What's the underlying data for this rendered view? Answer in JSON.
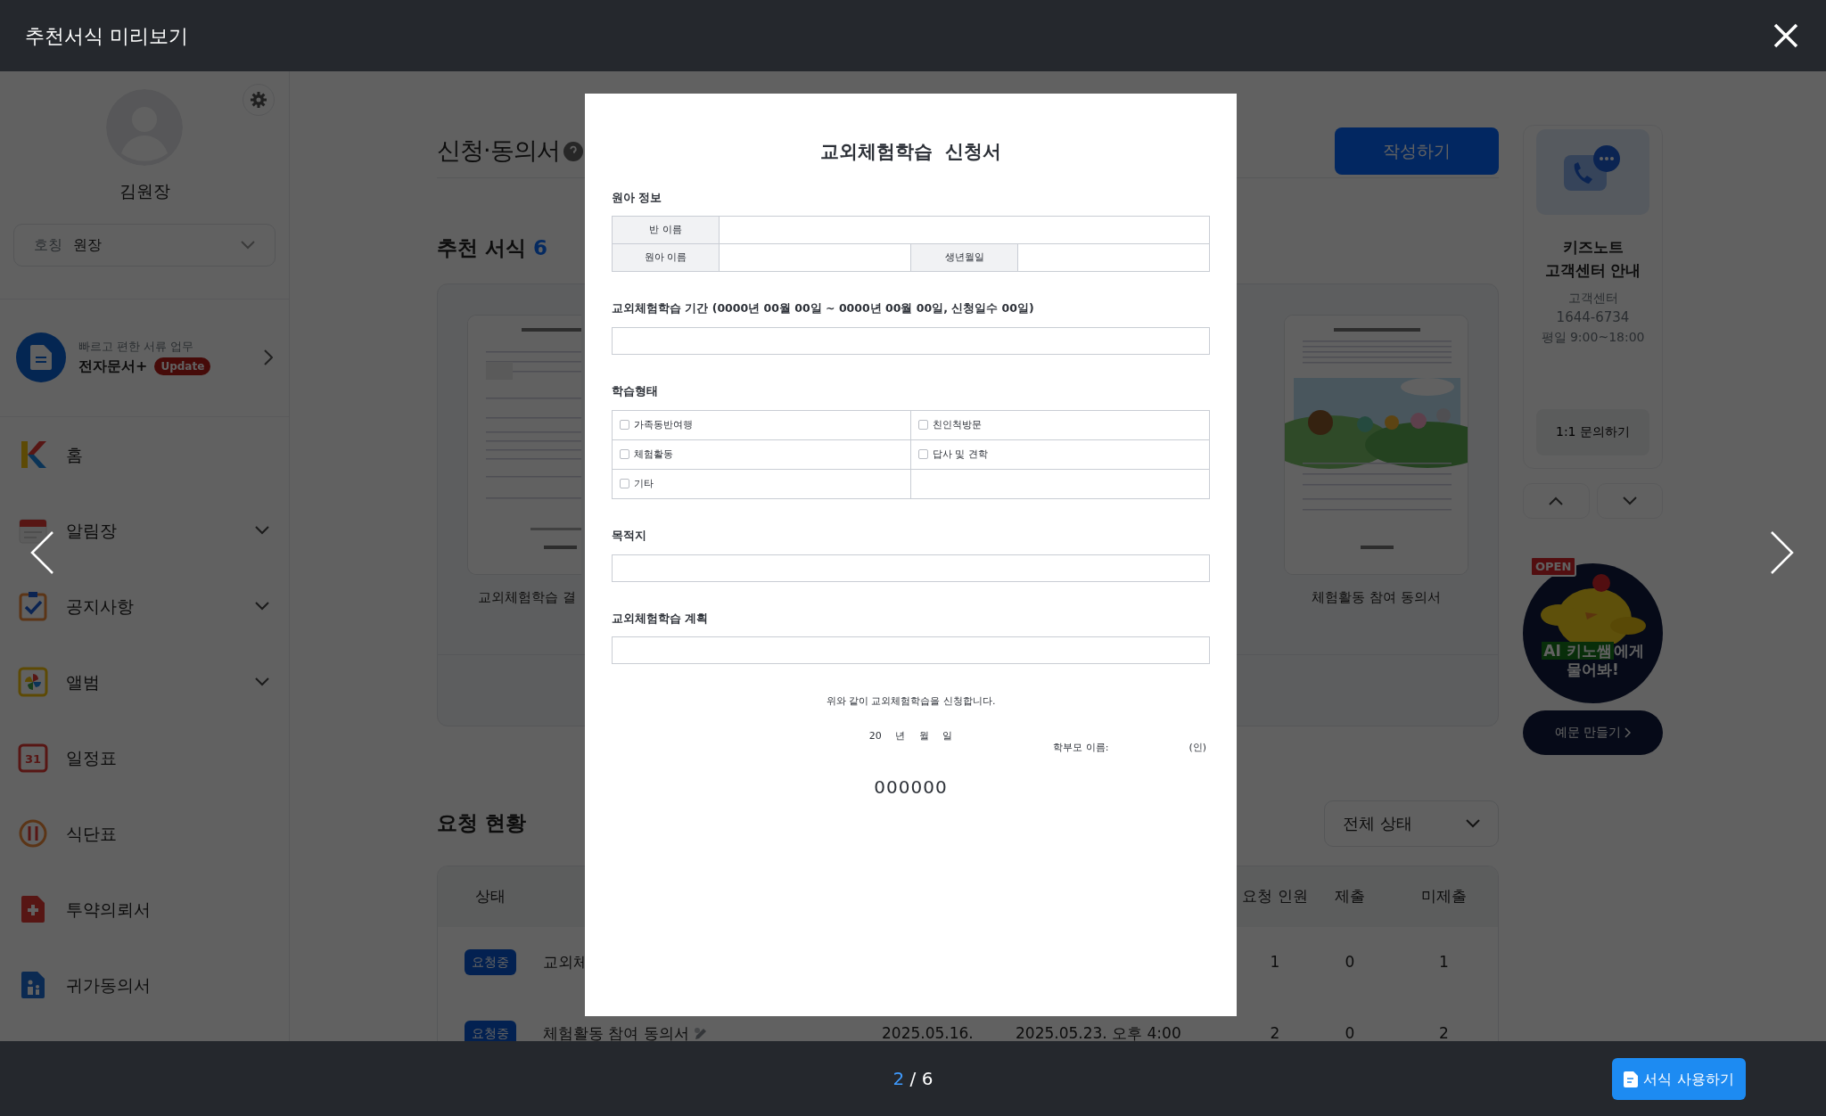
{
  "modal": {
    "title": "추천서식 미리보기",
    "page_current": "2",
    "page_separator": "/",
    "page_total": "6",
    "use_button": "서식 사용하기"
  },
  "document": {
    "title": "교외체험학습 신청서",
    "sections": [
      {
        "kind": "info_table",
        "heading": "원아 정보",
        "rows": [
          [
            "반 이름"
          ],
          [
            "원아 이름",
            "생년월일"
          ]
        ]
      },
      {
        "kind": "field",
        "heading": "교외체험학습 기간 (0000년 00월 00일 ~ 0000년 00월 00일, 신청일수 00일)"
      },
      {
        "kind": "checkbox_grid",
        "heading": "학습형태",
        "options": [
          {
            "label": "가족동반여행",
            "checked": false
          },
          {
            "label": "친인척방문",
            "checked": false
          },
          {
            "label": "체험활동",
            "checked": false
          },
          {
            "label": "답사 및 견학",
            "checked": false
          },
          {
            "label": "기타",
            "checked": false
          }
        ]
      },
      {
        "kind": "field",
        "heading": "목적지"
      },
      {
        "kind": "field",
        "heading": "교외체험학습 계획"
      }
    ],
    "statement": "위와 같이 교외체험학습을 신청합니다.",
    "date_line": "20 년 월 일",
    "signature_label": "학부모 이름:",
    "seal": "(인)",
    "organization": "000000"
  },
  "sidebar": {
    "user_name": "김원장",
    "title_label": "호칭",
    "title_value": "원장",
    "promo_subtitle": "빠르고 편한 서류 업무",
    "promo_title": "전자문서+",
    "promo_badge": "Update",
    "nav": [
      {
        "kind": "home",
        "label": "홈",
        "expandable": false
      },
      {
        "kind": "notes",
        "label": "알림장",
        "expandable": true
      },
      {
        "kind": "notice",
        "label": "공지사항",
        "expandable": true
      },
      {
        "kind": "album",
        "label": "앨범",
        "expandable": true
      },
      {
        "kind": "calendar",
        "label": "일정표",
        "icon_text": "31",
        "expandable": false
      },
      {
        "kind": "meal",
        "label": "식단표",
        "expandable": false
      },
      {
        "kind": "medicine",
        "label": "투약의뢰서",
        "expandable": false
      },
      {
        "kind": "pickup",
        "label": "귀가동의서",
        "expandable": false
      }
    ]
  },
  "main": {
    "heading": "신청·동의서",
    "write_button": "작성하기",
    "templates_heading": "추천 서식",
    "templates_count": "6",
    "templates": [
      {
        "kind": "form",
        "caption": "교외체험학습 결"
      },
      {
        "kind": "illustrated",
        "caption": "체험활동 참여 동의서"
      }
    ],
    "requests_heading": "요청 현황",
    "status_filter": "전체 상태",
    "table": {
      "columns": [
        "상태",
        "요청 인원",
        "제출",
        "미제출"
      ],
      "rows": [
        {
          "status": "요청중",
          "title": "교외체",
          "editable": false,
          "count": "1",
          "submitted": "0",
          "unsubmitted": "1"
        },
        {
          "status": "요청중",
          "title": "체험활동 참여 동의서",
          "editable": true,
          "sent": "2025.05.16.",
          "deadline": "2025.05.23. 오후 4:00",
          "count": "2",
          "submitted": "0",
          "unsubmitted": "2"
        }
      ]
    }
  },
  "right_panel": {
    "card_title": "키즈노트",
    "card_subtitle": "고객센터 안내",
    "center_label": "고객센터",
    "phone": "1644-6734",
    "hours": "평일 9:00~18:00",
    "inquiry_button": "1:1 문의하기",
    "promo_sign": "OPEN",
    "promo_highlight": "AI 키노쌤",
    "promo_text": "에게 물어봐!",
    "example_button": "예문 만들기"
  }
}
